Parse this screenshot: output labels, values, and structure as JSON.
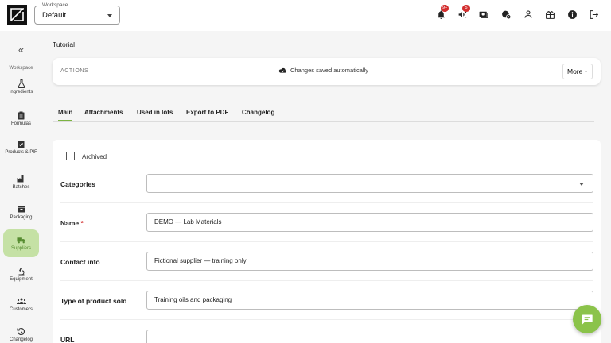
{
  "topbar": {
    "workspace_legend": "Workspace",
    "workspace_value": "Default",
    "notifications_badge": "9+",
    "announcements_badge": "5"
  },
  "sidebar": {
    "section": "Workspace",
    "items": [
      {
        "label": "Ingredients",
        "icon": "flask-icon"
      },
      {
        "label": "Formulas",
        "icon": "clipboard-icon"
      },
      {
        "label": "Products & PIF",
        "icon": "check-clipboard-icon"
      },
      {
        "label": "Batches",
        "icon": "factory-icon"
      },
      {
        "label": "Packaging",
        "icon": "box-icon"
      },
      {
        "label": "Suppliers",
        "icon": "truck-icon",
        "active": true
      },
      {
        "label": "Equipment",
        "icon": "microscope-icon"
      },
      {
        "label": "Customers",
        "icon": "people-icon"
      },
      {
        "label": "Changelog",
        "icon": "history-icon"
      }
    ]
  },
  "main": {
    "breadcrumb": "Tutorial",
    "actions_label": "ACTIONS",
    "saved_text": "Changes saved automatically",
    "more_label": "More",
    "tabs": [
      "Main",
      "Attachments",
      "Used in lots",
      "Export to PDF",
      "Changelog"
    ],
    "active_tab": "Main"
  },
  "form": {
    "archived_label": "Archived",
    "categories_label": "Categories",
    "categories_value": "",
    "name_label": "Name",
    "name_required": "*",
    "name_value": "DEMO — Lab Materials",
    "contact_label": "Contact info",
    "contact_value": "Fictional supplier — training only",
    "type_label": "Type of product sold",
    "type_value": "Training oils and packaging",
    "url_label": "URL",
    "url_value": ""
  },
  "colors": {
    "accent": "#8bc34a",
    "active_item_bg": "#c5e1a5",
    "badge": "#d32f2f"
  }
}
